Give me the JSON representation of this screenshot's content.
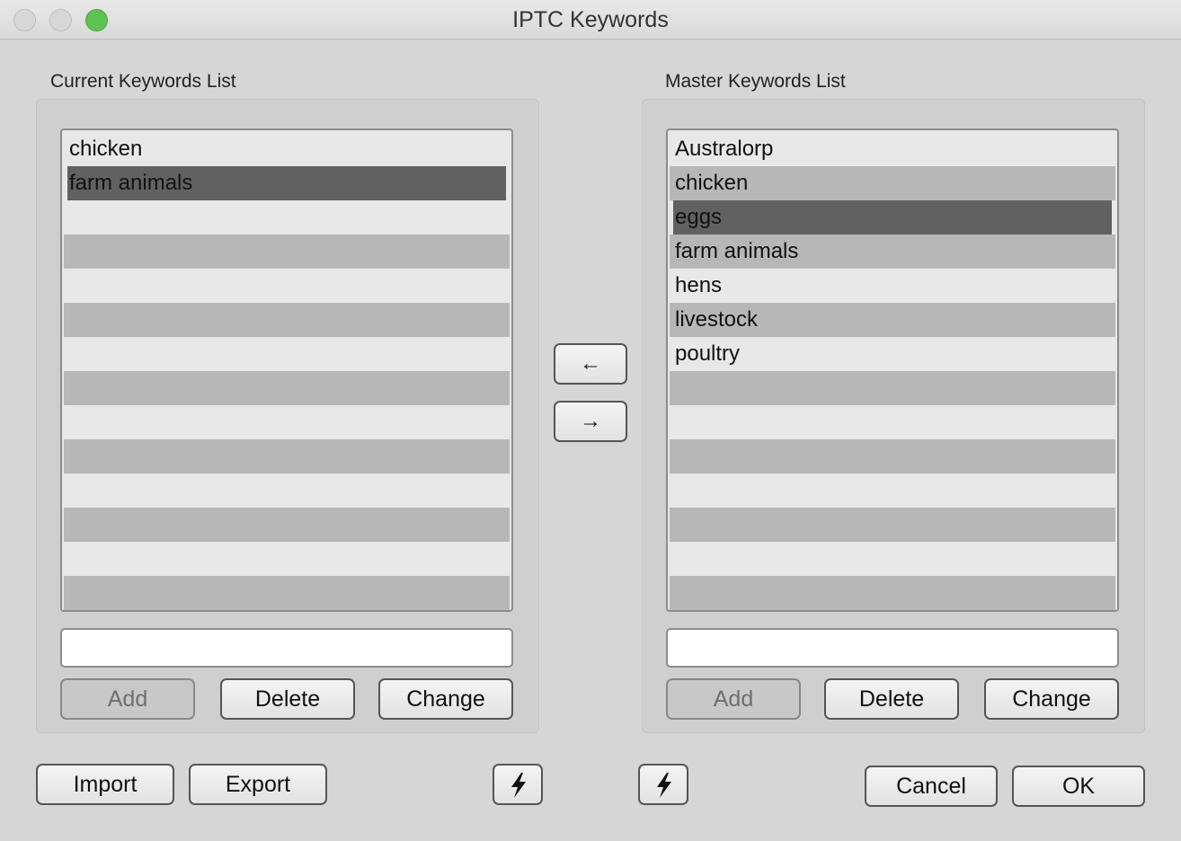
{
  "window": {
    "title": "IPTC Keywords"
  },
  "current": {
    "label": "Current Keywords List",
    "items": [
      "chicken",
      "farm animals",
      "",
      "",
      "",
      "",
      "",
      "",
      "",
      "",
      "",
      "",
      "",
      ""
    ],
    "selected_index": 1,
    "input_value": "",
    "buttons": {
      "add": "Add",
      "delete": "Delete",
      "change": "Change"
    }
  },
  "master": {
    "label": "Master Keywords List",
    "items": [
      "Australorp",
      "chicken",
      "eggs",
      "farm animals",
      "hens",
      "livestock",
      "poultry",
      "",
      "",
      "",
      "",
      "",
      "",
      ""
    ],
    "selected_index": 2,
    "input_value": "",
    "buttons": {
      "add": "Add",
      "delete": "Delete",
      "change": "Change"
    }
  },
  "transfer": {
    "left_arrow": "←",
    "right_arrow": "→"
  },
  "footer": {
    "import": "Import",
    "export": "Export",
    "cancel": "Cancel",
    "ok": "OK",
    "bolt_icon": "lightning-bolt-icon"
  },
  "colors": {
    "selected_row": "#616161",
    "zoom_button": "#5fc253"
  }
}
